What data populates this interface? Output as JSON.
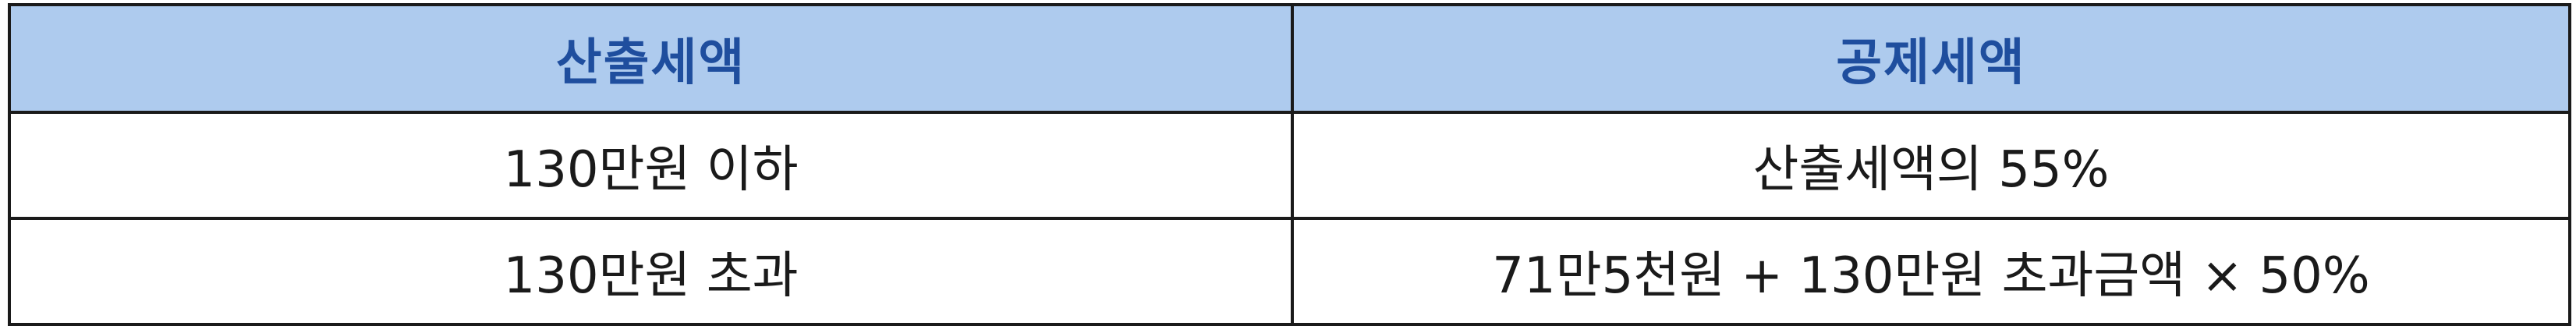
{
  "table": {
    "headers": [
      "산출세액",
      "공제세액"
    ],
    "rows": [
      [
        "130만원 이하",
        "산출세액의 55%"
      ],
      [
        "130만원 초과",
        "71만5천원 + 130만원 초과금액 × 50%"
      ]
    ]
  },
  "colors": {
    "header_bg": "#aecbee",
    "header_text": "#1f4e9e",
    "border": "#1a1a1a",
    "body_text": "#1a1a1a"
  }
}
